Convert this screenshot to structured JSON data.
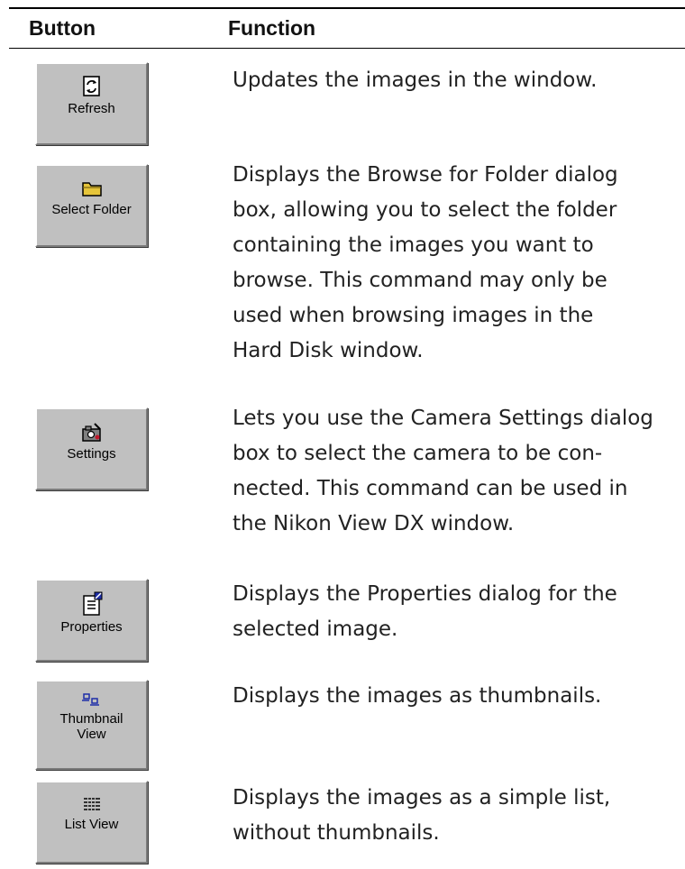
{
  "table": {
    "headers": {
      "button": "Button",
      "function": "Function"
    },
    "rows": [
      {
        "button_label": "Refresh",
        "icon": "refresh-icon",
        "description_lines": [
          "Updates the images in the window."
        ]
      },
      {
        "button_label": "Select Folder",
        "icon": "folder-icon",
        "description_lines": [
          "Displays the Browse for Folder dialog",
          "box, allowing you to select the folder",
          "containing the images you want to",
          "browse.  This command may only be",
          "used when browsing images in the",
          "Hard Disk window."
        ]
      },
      {
        "button_label": "Settings",
        "icon": "camera-settings-icon",
        "description_lines": [
          "Lets you use the Camera Settings dialog",
          "box to select the camera to be con-",
          "nected. This command can be used in",
          "the Nikon View DX window."
        ]
      },
      {
        "button_label": "Properties",
        "icon": "properties-icon",
        "description_lines": [
          "Displays the Properties dialog for the",
          "selected image."
        ]
      },
      {
        "button_label": "Thumbnail\nView",
        "icon": "thumbnail-view-icon",
        "description_lines": [
          "Displays the images as thumbnails."
        ]
      },
      {
        "button_label": "List View",
        "icon": "list-view-icon",
        "description_lines": [
          "Displays the images as a simple list,",
          "without thumbnails."
        ]
      }
    ]
  }
}
